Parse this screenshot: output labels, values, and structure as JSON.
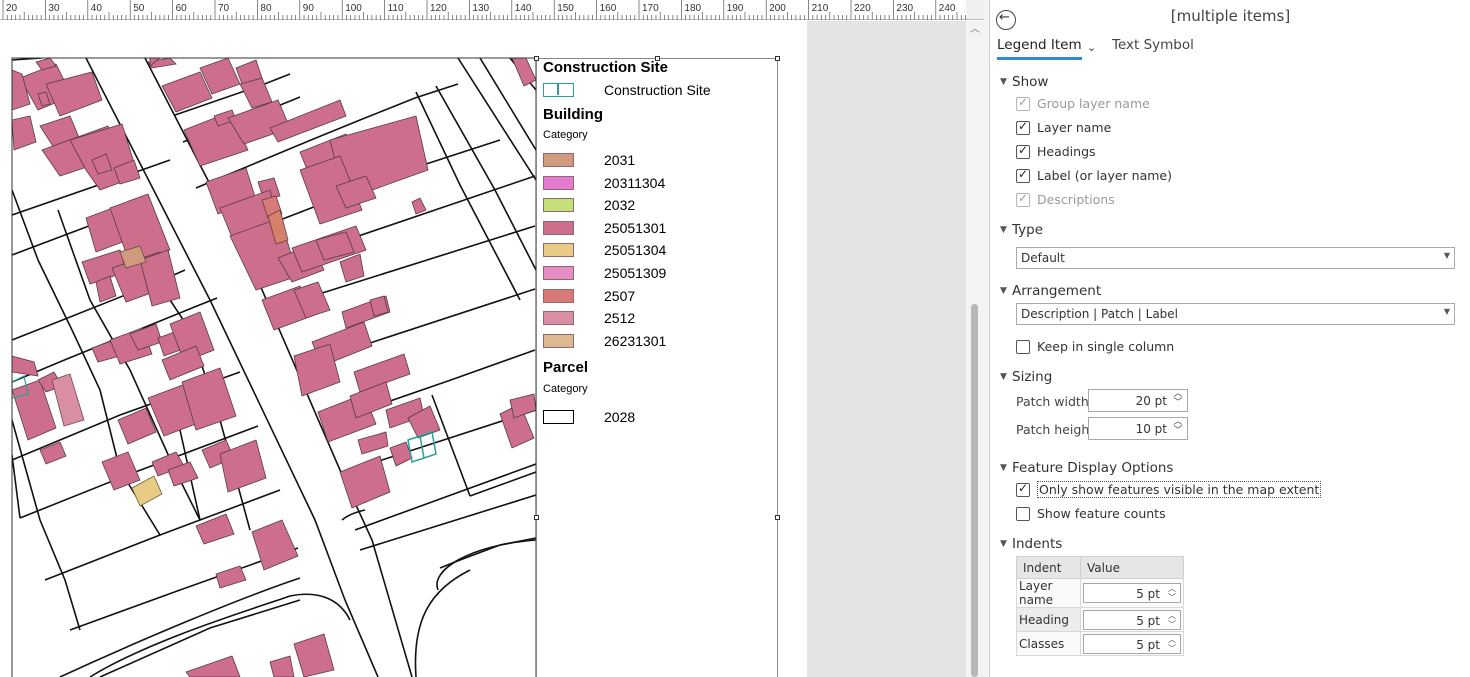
{
  "ruler": {
    "ticks": [
      "20",
      "30",
      "40",
      "50",
      "60",
      "70",
      "80",
      "90",
      "100",
      "110",
      "120",
      "130",
      "140",
      "150",
      "160",
      "170",
      "180",
      "190",
      "200",
      "210",
      "220",
      "230",
      "240"
    ]
  },
  "legend": {
    "construction_site": {
      "title": "Construction Site",
      "items": [
        {
          "label": "Construction Site",
          "color": "#2aa198",
          "style": "outline-split"
        }
      ]
    },
    "building": {
      "title": "Building",
      "heading": "Category",
      "items": [
        {
          "label": "2031",
          "color": "#cf9a7e"
        },
        {
          "label": "20311304",
          "color": "#e57ad1"
        },
        {
          "label": "2032",
          "color": "#c5e07a"
        },
        {
          "label": "25051301",
          "color": "#cc6e8c"
        },
        {
          "label": "25051304",
          "color": "#e8cc86"
        },
        {
          "label": "25051309",
          "color": "#e88cc4"
        },
        {
          "label": "2507",
          "color": "#d97a7a"
        },
        {
          "label": "2512",
          "color": "#d98fa3"
        },
        {
          "label": "26231301",
          "color": "#ddb98f"
        }
      ]
    },
    "parcel": {
      "title": "Parcel",
      "heading": "Category",
      "items": [
        {
          "label": "2028",
          "color": "#ffffff"
        }
      ]
    }
  },
  "pane": {
    "title": "[multiple items]",
    "tabs": {
      "legend_item": "Legend Item",
      "text_symbol": "Text Symbol"
    },
    "show": {
      "heading": "Show",
      "group_layer_name": "Group layer name",
      "layer_name": "Layer name",
      "headings": "Headings",
      "label": "Label (or layer name)",
      "descriptions": "Descriptions"
    },
    "type": {
      "heading": "Type",
      "value": "Default"
    },
    "arrangement": {
      "heading": "Arrangement",
      "value": "Description | Patch | Label",
      "single_column": "Keep in single column"
    },
    "sizing": {
      "heading": "Sizing",
      "patch_width_label": "Patch width",
      "patch_width": "20 pt",
      "patch_height_label": "Patch height",
      "patch_height": "10 pt"
    },
    "feature_display": {
      "heading": "Feature Display Options",
      "only_visible": "Only show features visible in the map extent",
      "show_counts": "Show feature counts"
    },
    "indents": {
      "heading": "Indents",
      "col_indent": "Indent",
      "col_value": "Value",
      "rows": [
        {
          "name": "Layer name",
          "value": "5 pt"
        },
        {
          "name": "Heading",
          "value": "5 pt"
        },
        {
          "name": "Classes",
          "value": "5 pt"
        }
      ]
    }
  }
}
